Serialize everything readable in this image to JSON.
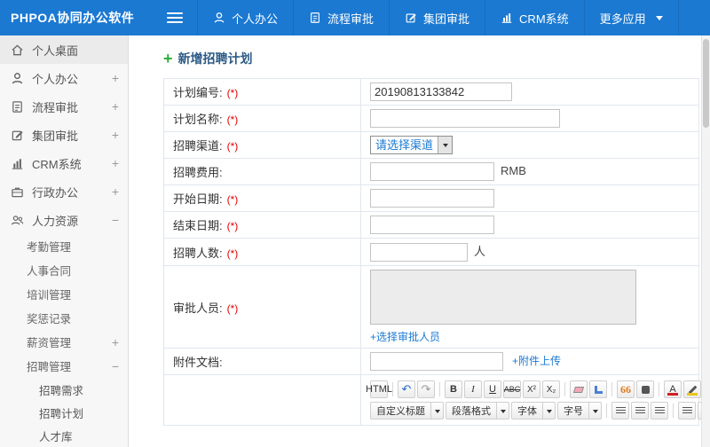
{
  "topbar": {
    "brand": "PHPOA协同办公软件",
    "nav": [
      {
        "label": "个人办公"
      },
      {
        "label": "流程审批"
      },
      {
        "label": "集团审批"
      },
      {
        "label": "CRM系统"
      },
      {
        "label": "更多应用"
      }
    ]
  },
  "sidebar": {
    "items": [
      {
        "label": "个人桌面",
        "expander": ""
      },
      {
        "label": "个人办公",
        "expander": "+"
      },
      {
        "label": "流程审批",
        "expander": "+"
      },
      {
        "label": "集团审批",
        "expander": "+"
      },
      {
        "label": "CRM系统",
        "expander": "+"
      },
      {
        "label": "行政办公",
        "expander": "+"
      },
      {
        "label": "人力资源",
        "expander": "−"
      }
    ],
    "hr_subitems": [
      {
        "label": "考勤管理",
        "expander": ""
      },
      {
        "label": "人事合同",
        "expander": ""
      },
      {
        "label": "培训管理",
        "expander": ""
      },
      {
        "label": "奖惩记录",
        "expander": ""
      },
      {
        "label": "薪资管理",
        "expander": "+"
      },
      {
        "label": "招聘管理",
        "expander": "−"
      }
    ],
    "recruit_subitems": [
      {
        "label": "招聘需求"
      },
      {
        "label": "招聘计划"
      },
      {
        "label": "人才库"
      }
    ]
  },
  "main": {
    "plus": "+",
    "title": "新增招聘计划",
    "form": {
      "required_mark": "(*)",
      "rows": {
        "plan_no": {
          "label": "计划编号:",
          "value": "20190813133842"
        },
        "plan_name": {
          "label": "计划名称:"
        },
        "channel": {
          "label": "招聘渠道:",
          "select_text": "请选择渠道"
        },
        "fee": {
          "label": "招聘费用:",
          "suffix": "RMB"
        },
        "start_date": {
          "label": "开始日期:"
        },
        "end_date": {
          "label": "结束日期:"
        },
        "headcount": {
          "label": "招聘人数:",
          "suffix": "人"
        },
        "approver": {
          "label": "审批人员:",
          "link": "+选择审批人员"
        },
        "attachment": {
          "label": "附件文档:",
          "link": "+附件上传"
        }
      }
    },
    "editor": {
      "html": "HTML",
      "undo": "↶",
      "redo": "↷",
      "bold": "B",
      "italic": "I",
      "underline": "U",
      "strike": "ABC",
      "sup": "X²",
      "sub": "X₂",
      "quote": "66",
      "fontcolor": "A",
      "dropdowns": [
        {
          "label": "自定义标题"
        },
        {
          "label": "段落格式"
        },
        {
          "label": "字体"
        },
        {
          "label": "字号"
        }
      ]
    }
  }
}
